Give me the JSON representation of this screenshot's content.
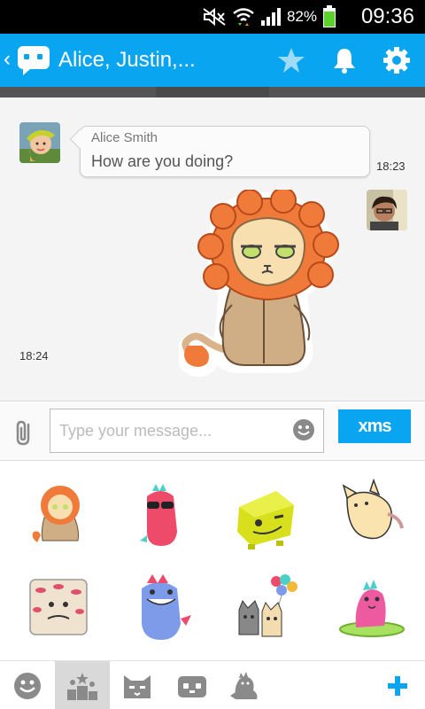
{
  "status_bar": {
    "battery_percent": "82%",
    "time": "09:36",
    "icons": [
      "mute-icon",
      "wifi-icon",
      "signal-icon",
      "battery-icon"
    ]
  },
  "action_bar": {
    "title": "Alice, Justin,...",
    "back_glyph": "‹",
    "buttons": [
      "star-icon",
      "bell-icon",
      "gear-icon"
    ]
  },
  "chat": {
    "messages": [
      {
        "sender": "Alice Smith",
        "text": "How are you doing?",
        "time": "18:23",
        "type": "text",
        "side": "left"
      },
      {
        "time": "18:24",
        "type": "sticker",
        "sticker": "lion-sticker",
        "side": "right"
      }
    ]
  },
  "composer": {
    "placeholder": "Type your message...",
    "value": "",
    "send_label": "xms"
  },
  "stickers": [
    "lion",
    "pink-dino-sunglasses",
    "yellow-cube-wink",
    "flying-cat",
    "lips-cube",
    "blue-dino",
    "cats-balloons",
    "surfing-pink-dino"
  ],
  "bottom_tabs": {
    "items": [
      "smiley",
      "top-stickers",
      "cat",
      "robot",
      "dino"
    ],
    "selected": "top-stickers",
    "add_label": "+"
  },
  "colors": {
    "accent": "#0aa5f0",
    "status_bar": "#000000",
    "battery_green": "#5bd22b"
  }
}
